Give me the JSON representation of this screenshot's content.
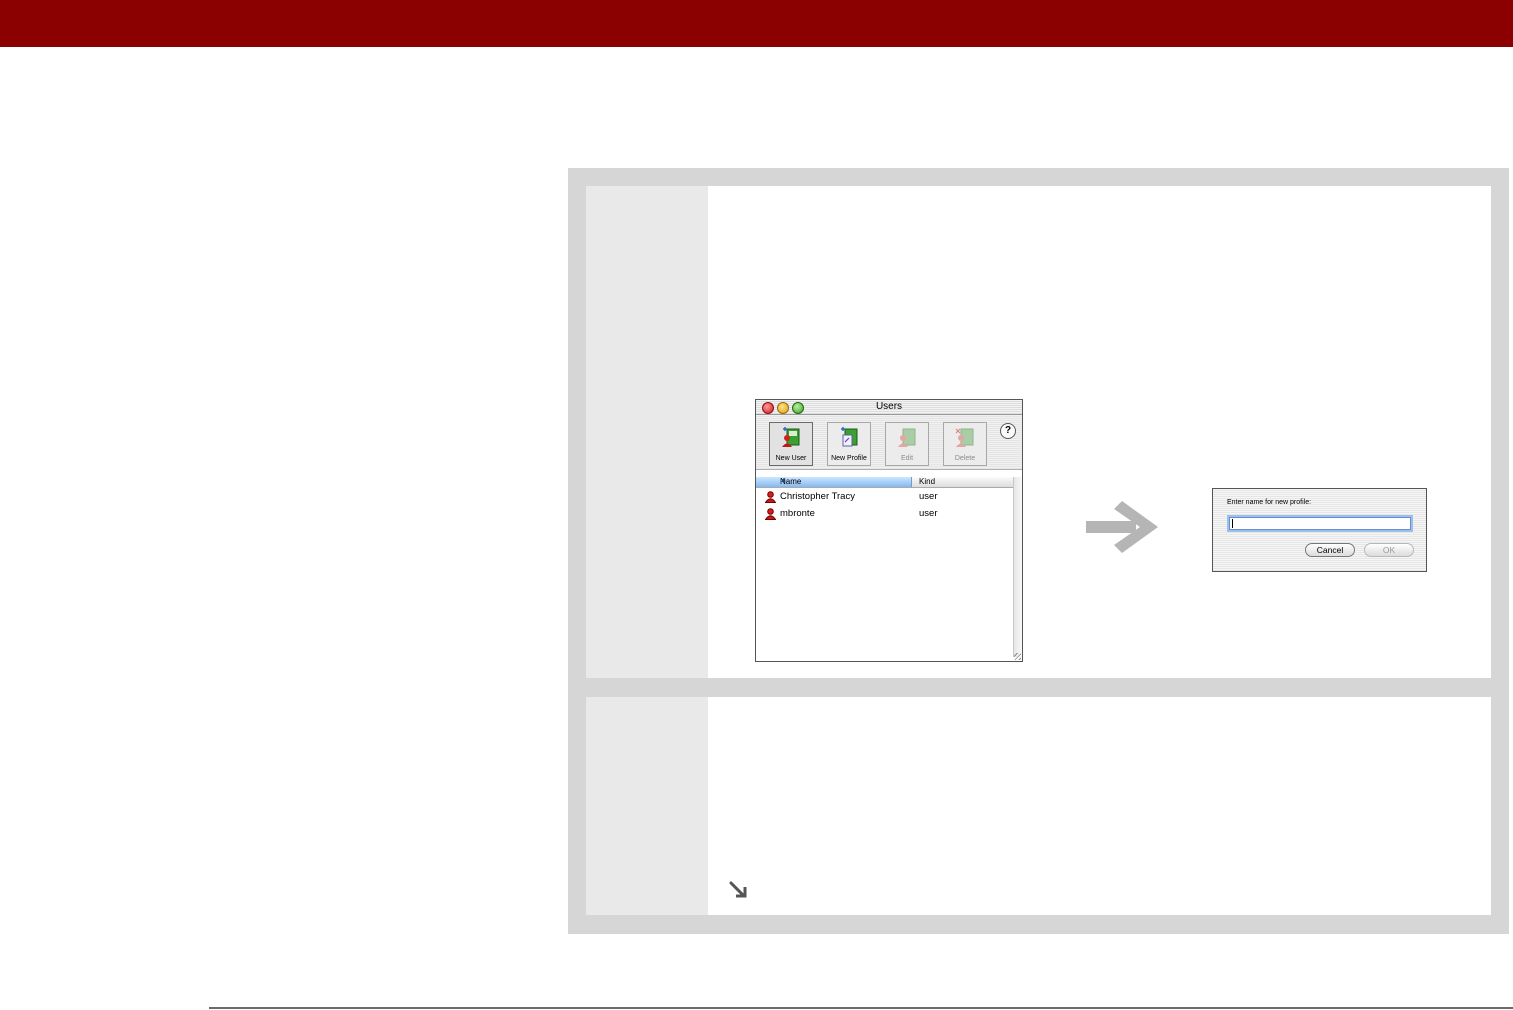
{
  "users_window": {
    "title": "Users",
    "toolbar": [
      {
        "label": "New User",
        "state": "active"
      },
      {
        "label": "New Profile",
        "state": "normal"
      },
      {
        "label": "Edit",
        "state": "disabled"
      },
      {
        "label": "Delete",
        "state": "disabled"
      }
    ],
    "help_label": "?",
    "columns": {
      "name": "Name",
      "kind": "Kind"
    },
    "rows": [
      {
        "name": "Christopher Tracy",
        "kind": "user"
      },
      {
        "name": "mbronte",
        "kind": "user"
      }
    ]
  },
  "dialog": {
    "prompt": "Enter name for new profile:",
    "input_value": "",
    "cancel_label": "Cancel",
    "ok_label": "OK"
  },
  "colors": {
    "header_bar": "#8b0000",
    "panel_gray": "#d6d6d6",
    "arrow_gray": "#b5b5b5",
    "selection_blue": "#84b9f0"
  },
  "icons": {
    "step_arrow": "right-arrow-icon",
    "continue_marker": "down-right-arrow-icon",
    "user_row": "user-icon"
  }
}
